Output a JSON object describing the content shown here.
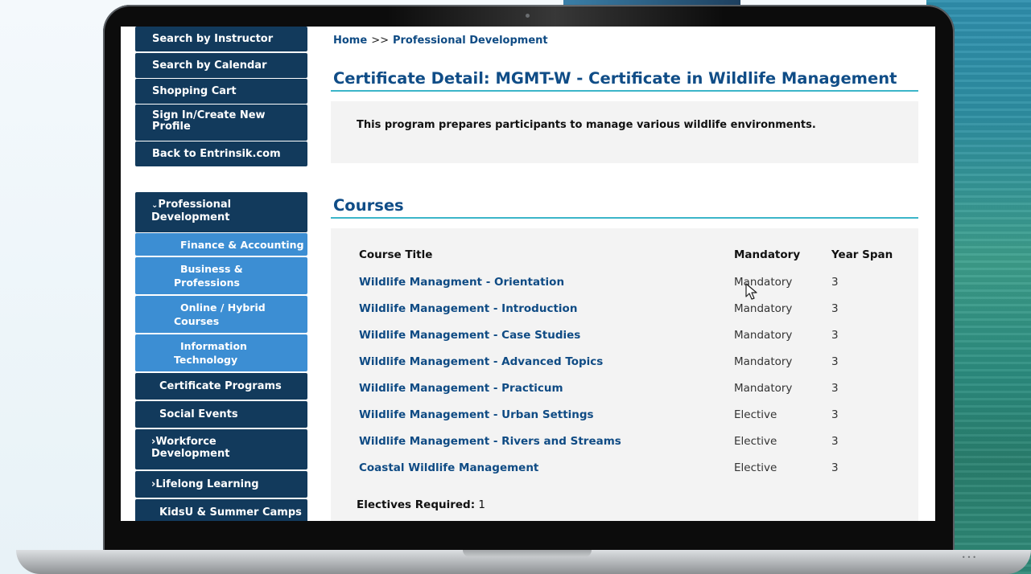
{
  "sidebar": {
    "items": [
      {
        "label": "Search by Instructor"
      },
      {
        "label": "Search by Calendar"
      },
      {
        "label": "Shopping Cart"
      },
      {
        "label": "Sign In/Create New Profile",
        "line1": "Sign In/Create New",
        "line2": "Profile"
      },
      {
        "label": "Back to Entrinsik.com"
      }
    ],
    "categories": [
      {
        "label": "Professional Development",
        "line1": "Professional",
        "line2": "Development",
        "expanded": true,
        "chevron": "chevron-down-icon"
      },
      {
        "label": "Finance & Accounting",
        "sub": true
      },
      {
        "label": "Business & Professions",
        "line1": "Business &",
        "line2": "Professions",
        "sub": true
      },
      {
        "label": "Online / Hybrid Courses",
        "line1": "Online / Hybrid",
        "line2": "Courses",
        "sub": true
      },
      {
        "label": "Information Technology",
        "line1": "Information",
        "line2": "Technology",
        "sub": true
      },
      {
        "label": "Certificate Programs"
      },
      {
        "label": "Social Events"
      },
      {
        "label": "Workforce Development",
        "line1": "Workforce",
        "line2": "Development",
        "expanded": false,
        "chevron": "chevron-right-icon"
      },
      {
        "label": "Lifelong Learning",
        "expanded": false,
        "chevron": "chevron-right-icon"
      },
      {
        "label": "KidsU & Summer Camps"
      }
    ]
  },
  "breadcrumb": {
    "home": "Home",
    "separator": ">>",
    "current": "Professional Development"
  },
  "page": {
    "title": "Certificate Detail: MGMT-W - Certificate in Wildlife Management",
    "description": "This program prepares participants to manage various wildlife environments."
  },
  "courses": {
    "heading": "Courses",
    "columns": [
      "Course Title",
      "Mandatory",
      "Year Span"
    ],
    "rows": [
      {
        "title": "Wildlife Managment - Orientation",
        "mandatory": "Mandatory",
        "year_span": "3"
      },
      {
        "title": "Wildlife Management - Introduction",
        "mandatory": "Mandatory",
        "year_span": "3"
      },
      {
        "title": "Wildlife Management - Case Studies",
        "mandatory": "Mandatory",
        "year_span": "3"
      },
      {
        "title": "Wildlife Management - Advanced Topics",
        "mandatory": "Mandatory",
        "year_span": "3"
      },
      {
        "title": "Wildlife Management - Practicum",
        "mandatory": "Mandatory",
        "year_span": "3"
      },
      {
        "title": "Wildlife Management - Urban Settings",
        "mandatory": "Elective",
        "year_span": "3"
      },
      {
        "title": "Wildlife Management - Rivers and Streams",
        "mandatory": "Elective",
        "year_span": "3"
      },
      {
        "title": "Coastal Wildlife Management",
        "mandatory": "Elective",
        "year_span": "3"
      }
    ],
    "electives_label": "Electives Required:",
    "electives_value": "1"
  },
  "colors": {
    "nav_dark": "#123a5c",
    "nav_sub": "#3c8ed3",
    "link": "#0f4b84",
    "accent_rule": "#3bb5c9"
  }
}
